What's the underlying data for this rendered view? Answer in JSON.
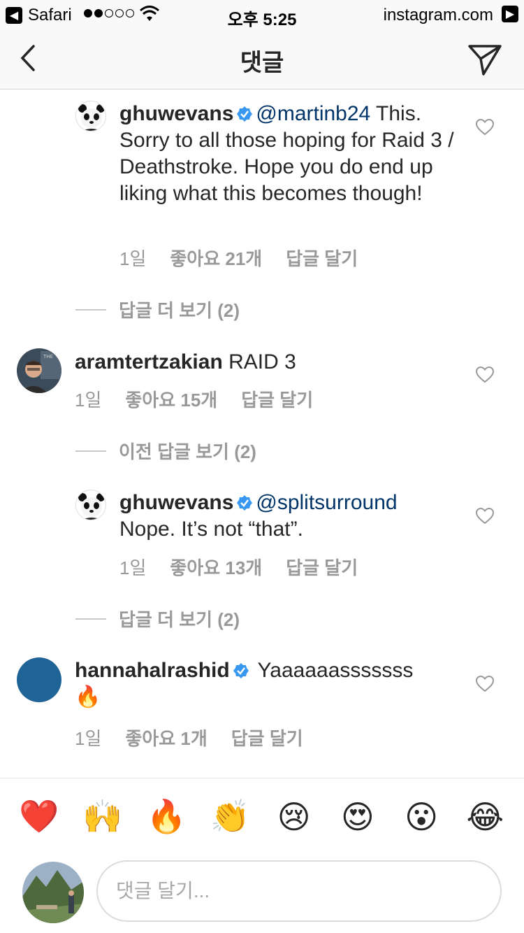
{
  "status_bar": {
    "app": "Safari",
    "time": "오후 5:25",
    "host": "instagram.com"
  },
  "nav": {
    "title": "댓글"
  },
  "comments": [
    {
      "username": "ghuwevans",
      "verified": true,
      "mention": "@martinb24",
      "text": " This. Sorry to all those hoping for Raid 3 / Deathstroke. Hope you do end up liking what this becomes though!",
      "age": "1일",
      "likes": "좋아요 21개",
      "reply": "답글 달기"
    },
    {
      "username": "aramtertzakian",
      "verified": false,
      "text": " RAID 3",
      "age": "1일",
      "likes": "좋아요 15개",
      "reply": "답글 달기"
    },
    {
      "username": "ghuwevans",
      "verified": true,
      "mention": "@splitsurround",
      "text": "Nope. It’s not “that”.",
      "age": "1일",
      "likes": "좋아요 13개",
      "reply": "답글 달기"
    },
    {
      "username": "hannahalrashid",
      "verified": true,
      "text": " Yaaaaaasssssss",
      "emoji": "🔥",
      "age": "1일",
      "likes": "좋아요 1개",
      "reply": "답글 달기"
    }
  ],
  "thread_links": [
    "답글 더 보기 (2)",
    "이전 답글 보기 (2)",
    "답글 더 보기 (2)"
  ],
  "avatar_colors": {
    "hannahalrashid": "#1f6497"
  },
  "emoji_bar": [
    "❤️",
    "🙌",
    "🔥",
    "👏",
    "😢",
    "😍",
    "😮",
    "😂"
  ],
  "compose": {
    "placeholder": "댓글 달기..."
  },
  "icons": {
    "back": "chevron-left-icon",
    "send": "paper-plane-icon",
    "verified": "verified-badge-icon",
    "like": "heart-outline-icon"
  }
}
